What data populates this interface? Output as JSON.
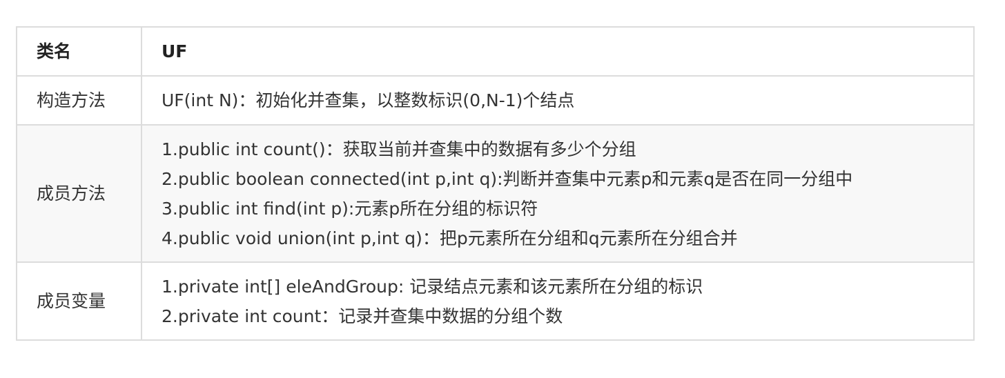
{
  "table": {
    "header": {
      "label": "类名",
      "value": "UF"
    },
    "rows": [
      {
        "label": "构造方法",
        "lines": [
          "UF(int N)：初始化并查集，以整数标识(0,N-1)个结点"
        ]
      },
      {
        "label": "成员方法",
        "lines": [
          "1.public int count()：获取当前并查集中的数据有多少个分组",
          "2.public boolean connected(int p,int q):判断并查集中元素p和元素q是否在同一分组中",
          "3.public int find(int p):元素p所在分组的标识符",
          "4.public void union(int p,int q)：把p元素所在分组和q元素所在分组合并"
        ]
      },
      {
        "label": "成员变量",
        "lines": [
          "1.private int[]  eleAndGroup: 记录结点元素和该元素所在分组的标识",
          "2.private int count：记录并查集中数据的分组个数"
        ]
      }
    ]
  }
}
